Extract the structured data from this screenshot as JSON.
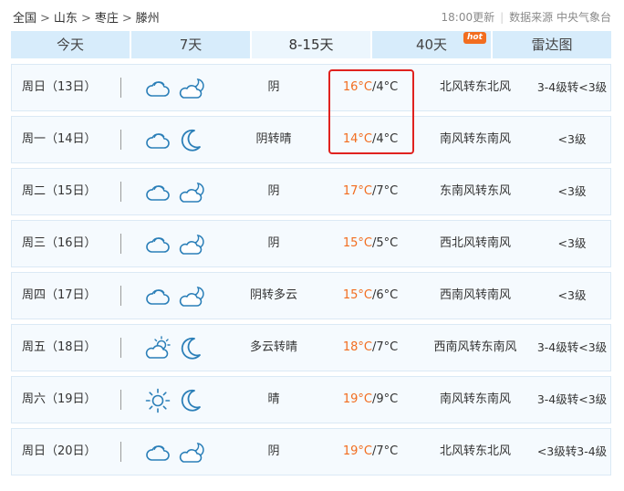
{
  "breadcrumb": {
    "items": [
      "全国",
      "山东",
      "枣庄",
      "滕州"
    ],
    "separator": ">"
  },
  "meta": {
    "update_time": "18:00更新",
    "source": "数据来源 中央气象台"
  },
  "tabs": [
    {
      "label": "今天",
      "active": false
    },
    {
      "label": "7天",
      "active": false
    },
    {
      "label": "8-15天",
      "active": true
    },
    {
      "label": "40天",
      "active": false,
      "badge": "hot"
    },
    {
      "label": "雷达图",
      "active": false
    }
  ],
  "colors": {
    "accent_temp": "#f26d1f",
    "tab_bg": "#d7ecfb",
    "highlight_border": "#e0221f",
    "icon_blue": "#2b7fb8"
  },
  "forecast": [
    {
      "day": "周日（13日）",
      "day_icon": "cloudy-icon",
      "night_icon": "partly-cloudy-night-icon",
      "weather": "阴",
      "high": "16°C",
      "low": "/4°C",
      "wind": "北风转东北风",
      "level": "3-4级转<3级"
    },
    {
      "day": "周一（14日）",
      "day_icon": "cloudy-icon",
      "night_icon": "moon-icon",
      "weather": "阴转晴",
      "high": "14°C",
      "low": "/4°C",
      "wind": "南风转东南风",
      "level": "<3级"
    },
    {
      "day": "周二（15日）",
      "day_icon": "cloudy-icon",
      "night_icon": "partly-cloudy-night-icon",
      "weather": "阴",
      "high": "17°C",
      "low": "/7°C",
      "wind": "东南风转东风",
      "level": "<3级"
    },
    {
      "day": "周三（16日）",
      "day_icon": "cloudy-icon",
      "night_icon": "partly-cloudy-night-icon",
      "weather": "阴",
      "high": "15°C",
      "low": "/5°C",
      "wind": "西北风转南风",
      "level": "<3级"
    },
    {
      "day": "周四（17日）",
      "day_icon": "cloudy-icon",
      "night_icon": "partly-cloudy-night-icon",
      "weather": "阴转多云",
      "high": "15°C",
      "low": "/6°C",
      "wind": "西南风转南风",
      "level": "<3级"
    },
    {
      "day": "周五（18日）",
      "day_icon": "partly-cloudy-day-icon",
      "night_icon": "moon-icon",
      "weather": "多云转晴",
      "high": "18°C",
      "low": "/7°C",
      "wind": "西南风转东南风",
      "level": "3-4级转<3级"
    },
    {
      "day": "周六（19日）",
      "day_icon": "sun-icon",
      "night_icon": "moon-icon",
      "weather": "晴",
      "high": "19°C",
      "low": "/9°C",
      "wind": "南风转东南风",
      "level": "3-4级转<3级"
    },
    {
      "day": "周日（20日）",
      "day_icon": "cloudy-icon",
      "night_icon": "partly-cloudy-night-icon",
      "weather": "阴",
      "high": "19°C",
      "low": "/7°C",
      "wind": "北风转东北风",
      "level": "<3级转3-4级"
    }
  ]
}
